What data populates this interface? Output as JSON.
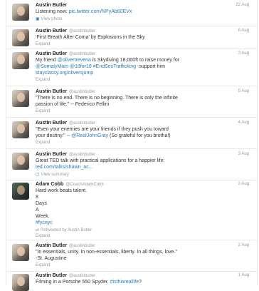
{
  "tweets": [
    {
      "name": "Austin Butler",
      "handle": "",
      "date": "22 Aug",
      "lines": [
        "Listening now: "
      ],
      "link": "pic.twitter.com/NPyAb60EVx",
      "action": "View photo"
    },
    {
      "name": "Austin Butler",
      "handle": "@austinbutler",
      "date": "6 Aug",
      "lines": [
        "'First Breath After Coma' by Explosions in the Sky"
      ],
      "action": "Expand"
    },
    {
      "name": "Austin Butler",
      "handle": "@austinbutler",
      "date": "3 Aug",
      "lines": [
        "My friend ",
        "@olivertrevena",
        " is Skydiving 18,000ft to raise money for",
        "@SomalyMam",
        " @18for18",
        " #EndSexTrafficking",
        " -support him",
        "stayclassy.org/oliversjump"
      ],
      "action": "Expand"
    },
    {
      "name": "Austin Butler",
      "handle": "@austinbutler",
      "date": "5 Aug",
      "lines": [
        "\"There is no end. There is no beginning. There is only the infinite",
        "passion of life.\" -- Federico Fellini"
      ],
      "action": "Expand"
    },
    {
      "name": "Austin Butler",
      "handle": "@austinbutler",
      "date": "4 Aug",
      "lines": [
        "\"Even your enemies are your friends if they push you toward",
        "your destiny.\" -- ",
        "@RealJohnGray",
        " (So grateful for you brotha!)"
      ],
      "action": "Expand"
    },
    {
      "name": "Austin Butler",
      "handle": "@austinbutler",
      "date": "3 Aug",
      "lines": [
        "Great TED talk with practical applications for a happier life:",
        "ted.com/talks/shawn_ac..."
      ],
      "action": "View summary"
    },
    {
      "name": "Adam Cobb",
      "handle": "@CoachAdamCobb",
      "date": "2 Aug",
      "lines": [
        "Hard work beats talent.",
        "8",
        "Days",
        "A",
        "Week.",
        "#fycnyc"
      ],
      "retweet": "Retweeted by Austin Butler",
      "action": "Expand"
    },
    {
      "name": "Austin Butler",
      "handle": "@austinbutler",
      "date": "2 Aug",
      "lines": [
        "\"In essentials, unity. In non-essentials, liberty. In all things, love.\"",
        "-St. Augustine"
      ],
      "action": "Expand"
    },
    {
      "name": "Austin Butler",
      "handle": "@austinbutler",
      "date": "1 Aug",
      "lines": [
        "Filming in a Porsche 550 Spyder. ",
        "#isthisreallife",
        "?"
      ]
    }
  ]
}
